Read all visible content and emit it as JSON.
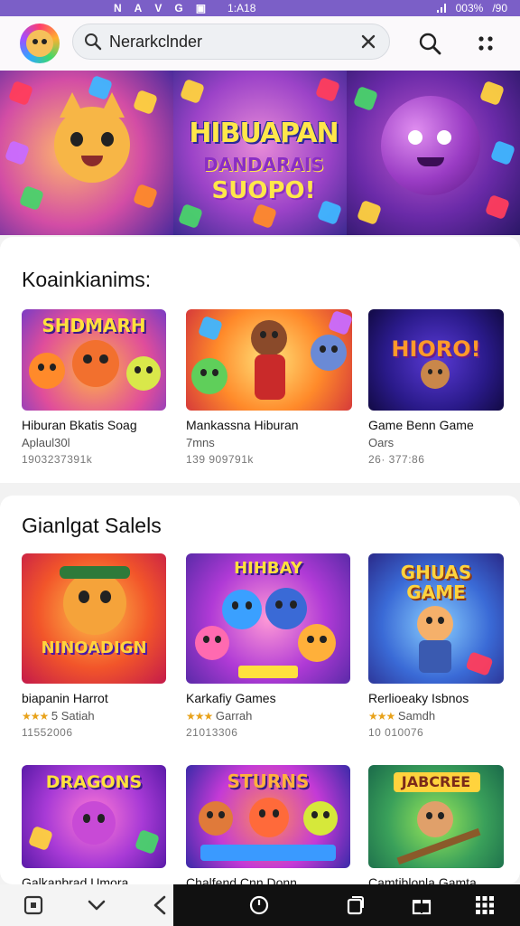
{
  "status_bar": {
    "left_glyphs": [
      "N",
      "A",
      "V",
      "G",
      "▣"
    ],
    "time": "1:A18",
    "battery": "003%",
    "right_text": "/90"
  },
  "top_bar": {
    "logo_icon": "app-logo-icon",
    "search": {
      "value": "Nerarkclnder",
      "placeholder": "Search"
    },
    "icons": [
      "search-icon",
      "close-icon",
      "search-icon",
      "more-icon"
    ]
  },
  "banner": {
    "title": "HIBUAPAN",
    "subtitle": "DANDARAIS",
    "subtitle2": "SUOPO!"
  },
  "section1": {
    "title": "Koainkianims:",
    "cards": [
      {
        "title": "Hiburan Bkatis Soag",
        "sub": "Aplaul30l",
        "meta": "1903237391k",
        "art_text": "SHDMARH"
      },
      {
        "title": "Mankassna Hiburan",
        "sub": "7mns",
        "meta": "139 909791k",
        "art_text": ""
      },
      {
        "title": "Game Benn Game",
        "sub": "Oars",
        "meta": "26· 377:86",
        "art_text": "HIORO!"
      }
    ]
  },
  "section2": {
    "title": "Gianlgat Salels",
    "cards": [
      {
        "title": "biapanin Harrot",
        "rating": "★★★",
        "sub": "5 Satiah",
        "meta": "11552006",
        "art_text": "NINOADIGN"
      },
      {
        "title": "Karkafiy Games",
        "rating": "★★★",
        "sub": "Garrah",
        "meta": "21013306",
        "art_text": "HIHBAY"
      },
      {
        "title": "Rerlioeaky Isbnos",
        "rating": "★★★",
        "sub": "Samdh",
        "meta": "10 010076",
        "art_text": "GHUAS GAME"
      }
    ],
    "row2": [
      {
        "title": "Galkanbrad Umora",
        "art_text": "DRAGONS"
      },
      {
        "title": "Chalfend Cnn Donn",
        "art_text": "STURNS"
      },
      {
        "title": "Camtiblonla Gamta",
        "art_text": "JABCREE"
      }
    ]
  },
  "bottom_nav": {
    "icons": [
      "square-icon",
      "chevron-down-icon",
      "back-icon",
      "clock-icon",
      "copy-icon",
      "gift-icon",
      "grid-icon"
    ]
  },
  "colors": {
    "status_bar": "#7b5fc7",
    "accent_yellow": "#ffe13d",
    "star": "#e8a21a"
  }
}
